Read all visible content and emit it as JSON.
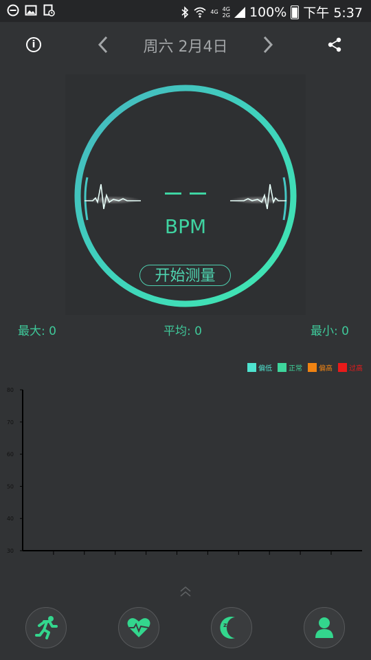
{
  "status_bar": {
    "network_top": "4G",
    "network_sub_top": "4G",
    "network_sub_bottom": "2G",
    "battery": "100%",
    "time": "下午 5:37"
  },
  "header": {
    "date": "周六  2月4日",
    "icons": [
      "info-icon",
      "chevron-left-icon",
      "chevron-right-icon",
      "share-icon"
    ]
  },
  "measure": {
    "value": "– –",
    "unit": "BPM",
    "start_label": "开始测量"
  },
  "stats": {
    "max": "最大: 0",
    "avg": "平均: 0",
    "min": "最小: 0"
  },
  "legend": [
    {
      "label": "偏低",
      "color": "#4ee3cf"
    },
    {
      "label": "正常",
      "color": "#3ed69c"
    },
    {
      "label": "偏高",
      "color": "#f08312"
    },
    {
      "label": "过高",
      "color": "#e81a1a"
    }
  ],
  "chart_data": {
    "type": "line",
    "x": [],
    "series": [],
    "title": "",
    "xlabel": "",
    "ylabel": "",
    "ylim": [
      30,
      80
    ],
    "y_ticks": [
      80,
      70,
      60,
      50,
      40,
      30
    ],
    "x_tick_count": 11
  },
  "bottom_nav": [
    {
      "name": "run-icon"
    },
    {
      "name": "heart-icon"
    },
    {
      "name": "sleep-icon"
    },
    {
      "name": "profile-icon"
    }
  ]
}
